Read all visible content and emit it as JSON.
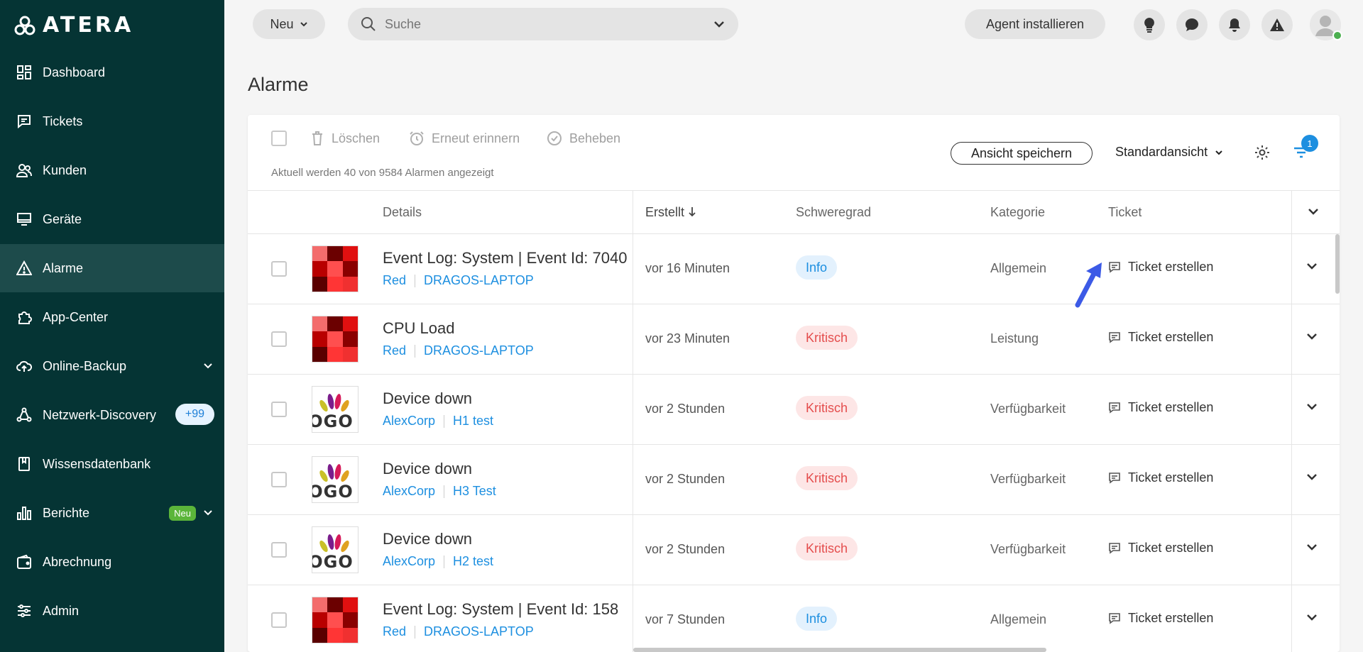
{
  "sidebar": {
    "logo": "ATERA",
    "items": [
      {
        "label": "Dashboard"
      },
      {
        "label": "Tickets"
      },
      {
        "label": "Kunden"
      },
      {
        "label": "Geräte"
      },
      {
        "label": "Alarme"
      },
      {
        "label": "App-Center"
      },
      {
        "label": "Online-Backup"
      },
      {
        "label": "Netzwerk-Discovery",
        "badge": "+99"
      },
      {
        "label": "Wissensdatenbank"
      },
      {
        "label": "Berichte",
        "badge": "Neu"
      },
      {
        "label": "Abrechnung"
      },
      {
        "label": "Admin"
      }
    ]
  },
  "topbar": {
    "new_label": "Neu",
    "search_placeholder": "Suche",
    "agent_label": "Agent installieren"
  },
  "page": {
    "title": "Alarme"
  },
  "toolbar": {
    "delete_label": "Löschen",
    "remind_label": "Erneut erinnern",
    "resolve_label": "Beheben",
    "info": "Aktuell werden 40 von 9584 Alarmen angezeigt",
    "save_view_label": "Ansicht speichern",
    "view_label": "Standardansicht",
    "filter_count": "1"
  },
  "table": {
    "headers": {
      "details": "Details",
      "created": "Erstellt",
      "severity": "Schweregrad",
      "category": "Kategorie",
      "ticket": "Ticket"
    },
    "rows": [
      {
        "title": "Event Log: System | Event Id: 7040",
        "customer": "Red",
        "device": "DRAGOS-LAPTOP",
        "created": "vor 16 Minuten",
        "severity": "Info",
        "category": "Allgemein",
        "ticket": "Ticket erstellen"
      },
      {
        "title": "CPU Load",
        "customer": "Red",
        "device": "DRAGOS-LAPTOP",
        "created": "vor 23 Minuten",
        "severity": "Kritisch",
        "category": "Leistung",
        "ticket": "Ticket erstellen"
      },
      {
        "title": "Device down",
        "customer": "AlexCorp",
        "device": "H1 test",
        "created": "vor 2 Stunden",
        "severity": "Kritisch",
        "category": "Verfügbarkeit",
        "ticket": "Ticket erstellen"
      },
      {
        "title": "Device down",
        "customer": "AlexCorp",
        "device": "H3 Test",
        "created": "vor 2 Stunden",
        "severity": "Kritisch",
        "category": "Verfügbarkeit",
        "ticket": "Ticket erstellen"
      },
      {
        "title": "Device down",
        "customer": "AlexCorp",
        "device": "H2 test",
        "created": "vor 2 Stunden",
        "severity": "Kritisch",
        "category": "Verfügbarkeit",
        "ticket": "Ticket erstellen"
      },
      {
        "title": "Event Log: System | Event Id: 158",
        "customer": "Red",
        "device": "DRAGOS-LAPTOP",
        "created": "vor 7 Stunden",
        "severity": "Info",
        "category": "Allgemein",
        "ticket": "Ticket erstellen"
      }
    ],
    "logo_word": "OGO"
  },
  "colors": {
    "sidebar": "#053434",
    "active": "#1d4b4b",
    "accent": "#1d8fe0",
    "critical": "#e44d4d"
  }
}
